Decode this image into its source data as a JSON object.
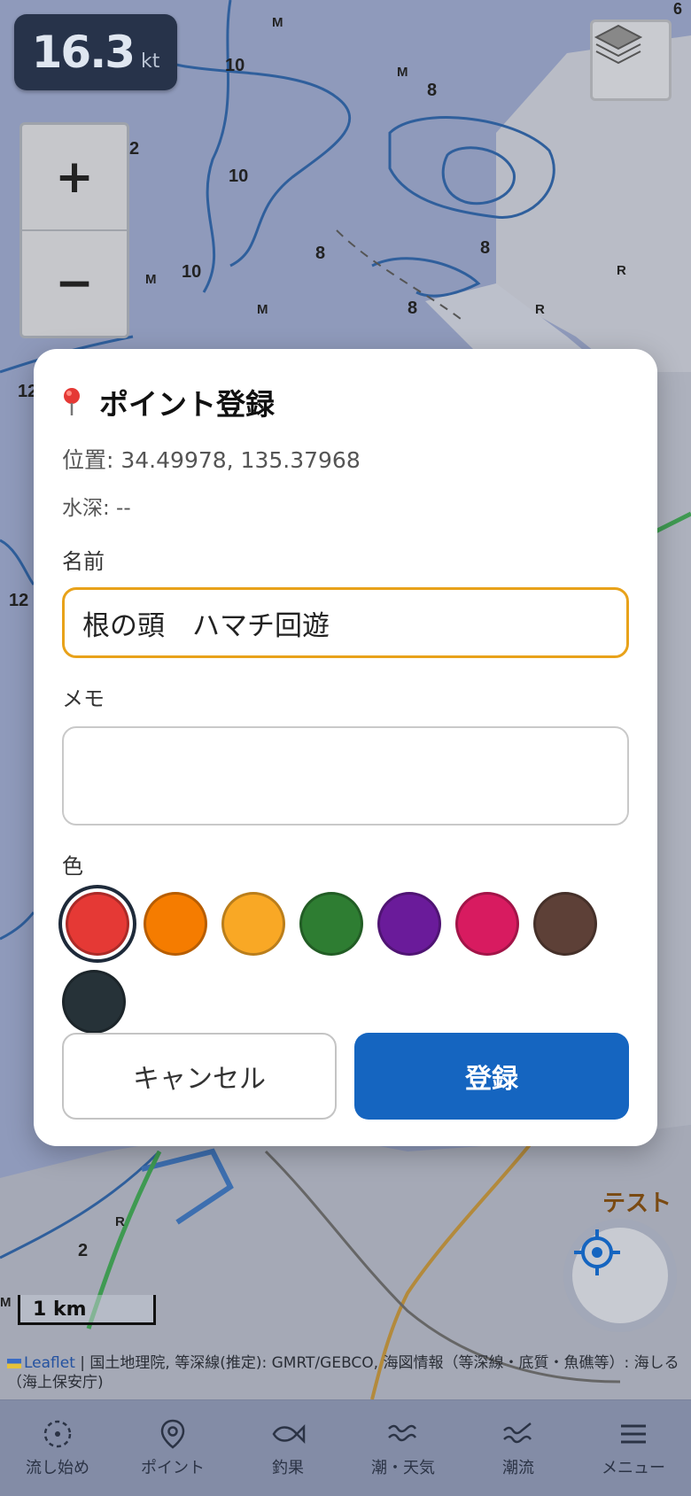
{
  "speed": {
    "value": "16.3",
    "unit": "kt"
  },
  "zoom": {
    "in_label": "+",
    "out_label": "−"
  },
  "map_labels": {
    "test": "テスト",
    "scale": "1 km"
  },
  "attribution": {
    "link": "Leaflet",
    "text": " | 国土地理院, 等深線(推定): GMRT/GEBCO, 海図情報（等深線・底質・魚礁等）: 海しる（海上保安庁)"
  },
  "dialog": {
    "title": "ポイント登録",
    "position": "位置: 34.49978, 135.37968",
    "depth": "水深: --",
    "name_label": "名前",
    "name_value": "根の頭　ハマチ回遊",
    "memo_label": "メモ",
    "memo_value": "",
    "color_label": "色",
    "colors": [
      "#e53935",
      "#f57c00",
      "#f9a825",
      "#2e7d32",
      "#6a1b9a",
      "#d81b60",
      "#5d4037",
      "#263238"
    ],
    "selected_color": "#e53935",
    "cancel_label": "キャンセル",
    "submit_label": "登録"
  },
  "nav": {
    "items": [
      {
        "label": "流し始め",
        "icon": "drift-start-icon"
      },
      {
        "label": "ポイント",
        "icon": "map-pin-icon"
      },
      {
        "label": "釣果",
        "icon": "fish-icon"
      },
      {
        "label": "潮・天気",
        "icon": "waves-icon"
      },
      {
        "label": "潮流",
        "icon": "current-icon"
      },
      {
        "label": "メニュー",
        "icon": "hamburger-icon"
      }
    ]
  }
}
